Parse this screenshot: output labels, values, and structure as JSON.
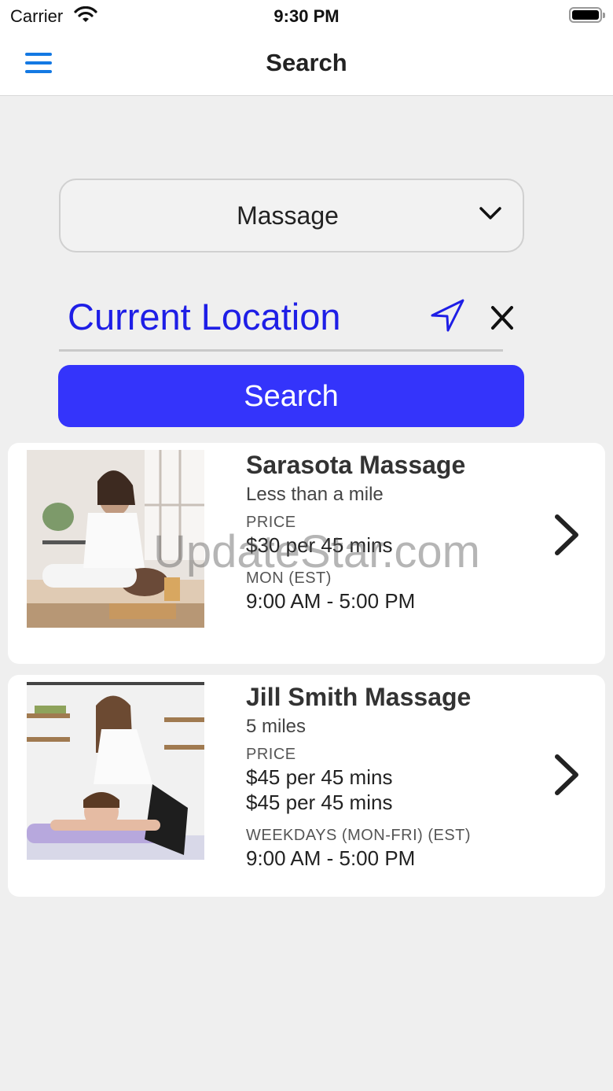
{
  "status_bar": {
    "carrier": "Carrier",
    "time": "9:30 PM"
  },
  "nav": {
    "title": "Search",
    "menu_icon": "hamburger-menu-icon"
  },
  "category_select": {
    "selected": "Massage",
    "icon": "chevron-down-icon"
  },
  "location": {
    "value": "Current Location",
    "locate_icon": "navigation-arrow-icon",
    "clear_icon": "close-icon"
  },
  "search_button": {
    "label": "Search"
  },
  "results": [
    {
      "name": "Sarasota Massage",
      "distance": "Less than a mile",
      "price_label": "PRICE",
      "prices": [
        "$30 per 45 mins"
      ],
      "hours_label": "MON (EST)",
      "hours": "9:00 AM - 5:00 PM"
    },
    {
      "name": "Jill Smith Massage",
      "distance": "5 miles",
      "price_label": "PRICE",
      "prices": [
        "$45 per 45 mins",
        "$45 per 45 mins"
      ],
      "hours_label": "WEEKDAYS (MON-FRI) (EST)",
      "hours": "9:00 AM - 5:00 PM"
    }
  ],
  "watermark": "UpdateStar.com",
  "colors": {
    "accent_blue": "#1479e3",
    "button_blue": "#3434fb",
    "location_text": "#1e1ee6"
  }
}
